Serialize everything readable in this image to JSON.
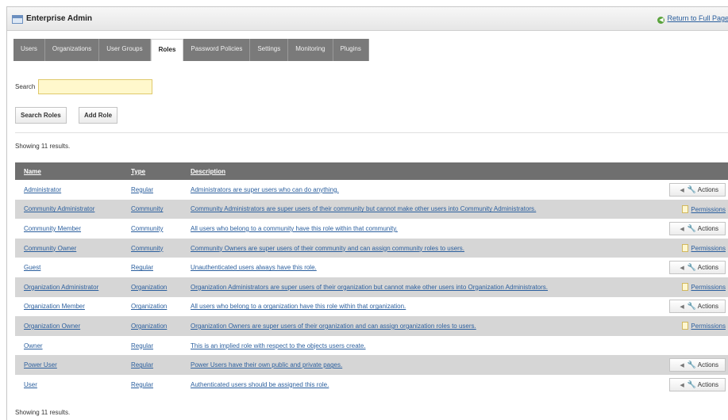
{
  "header": {
    "title": "Enterprise Admin",
    "return_link": "Return to Full Page",
    "return_arrow": "◀"
  },
  "tabs": [
    {
      "label": "Users",
      "active": false
    },
    {
      "label": "Organizations",
      "active": false
    },
    {
      "label": "User Groups",
      "active": false
    },
    {
      "label": "Roles",
      "active": true
    },
    {
      "label": "Password Policies",
      "active": false
    },
    {
      "label": "Settings",
      "active": false
    },
    {
      "label": "Monitoring",
      "active": false
    },
    {
      "label": "Plugins",
      "active": false
    }
  ],
  "search": {
    "label": "Search",
    "value": ""
  },
  "buttons": {
    "search_roles": "Search Roles",
    "add_role": "Add Role"
  },
  "results_text": "Showing 11 results.",
  "table": {
    "headers": {
      "name": "Name",
      "type": "Type",
      "description": "Description"
    },
    "rows": [
      {
        "name": "Administrator",
        "type": "Regular",
        "description": "Administrators are super users who can do anything.",
        "action": "Actions"
      },
      {
        "name": "Community Administrator",
        "type": "Community",
        "description": "Community Administrators are super users of their community but cannot make other users into Community Administrators.",
        "action": "Permissions"
      },
      {
        "name": "Community Member",
        "type": "Community",
        "description": "All users who belong to a community have this role within that community.",
        "action": "Actions"
      },
      {
        "name": "Community Owner",
        "type": "Community",
        "description": "Community Owners are super users of their community and can assign community roles to users.",
        "action": "Permissions"
      },
      {
        "name": "Guest",
        "type": "Regular",
        "description": "Unauthenticated users always have this role.",
        "action": "Actions"
      },
      {
        "name": "Organization Administrator",
        "type": "Organization",
        "description": "Organization Administrators are super users of their organization but cannot make other users into Organization Administrators.",
        "action": "Permissions"
      },
      {
        "name": "Organization Member",
        "type": "Organization",
        "description": "All users who belong to a organization have this role within that organization.",
        "action": "Actions"
      },
      {
        "name": "Organization Owner",
        "type": "Organization",
        "description": "Organization Owners are super users of their organization and can assign organization roles to users.",
        "action": "Permissions"
      },
      {
        "name": "Owner",
        "type": "Regular",
        "description": "This is an implied role with respect to the objects users create.",
        "action": ""
      },
      {
        "name": "Power User",
        "type": "Regular",
        "description": "Power Users have their own public and private pages.",
        "action": "Actions"
      },
      {
        "name": "User",
        "type": "Regular",
        "description": "Authenticated users should be assigned this role.",
        "action": "Actions"
      }
    ]
  },
  "icons": {
    "actions": "wrench-icon",
    "permissions": "page-icon",
    "header": "window-icon"
  },
  "colors": {
    "tab_bg": "#7a7a7a",
    "header_bg": "#6f6f6f",
    "alt_row": "#d6d6d6",
    "link": "#2b5f9e",
    "search_bg": "#fff8cc"
  }
}
